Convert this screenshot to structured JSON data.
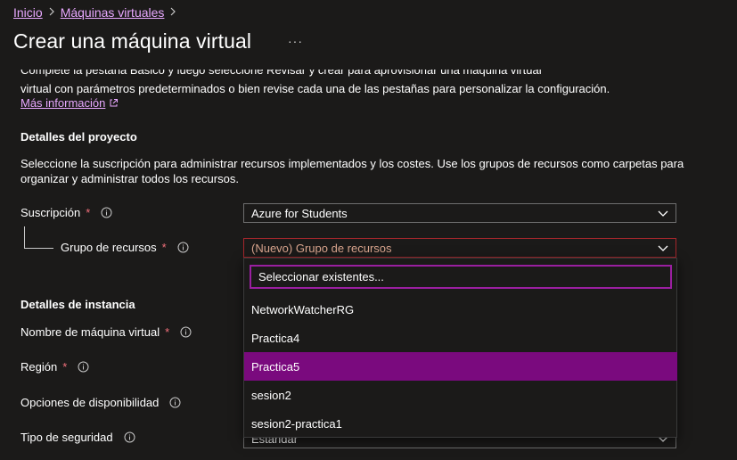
{
  "breadcrumb": {
    "home": "Inicio",
    "current": "Máquinas virtuales",
    "separator": ">"
  },
  "page": {
    "title": "Crear una máquina virtual",
    "more_label": "···"
  },
  "intro": {
    "cut_line": "Complete la pestaña Básico y luego seleccione Revisar y crear para aprovisionar una máquina virtual",
    "line2": "virtual con parámetros predeterminados o bien revise cada una de las pestañas para personalizar la configuración.",
    "more_link": "Más información"
  },
  "project": {
    "heading": "Detalles del proyecto",
    "desc1": "Seleccione la suscripción para administrar recursos implementados y los costes. Use los grupos de recursos como carpetas para",
    "desc2": "organizar y administrar todos los recursos.",
    "subscription_label": "Suscripción",
    "subscription_value": "Azure for Students",
    "resource_group_label": "Grupo de recursos",
    "resource_group_value": "(Nuevo) Grupo de recursos",
    "required_mark": "*"
  },
  "dropdown": {
    "search_placeholder": "Seleccionar existentes...",
    "options": [
      "NetworkWatcherRG",
      "Practica4",
      "Practica5",
      "sesion2",
      "sesion2-practica1"
    ],
    "selected_index": 2,
    "selected_color": "#7a0a7e"
  },
  "instance": {
    "heading": "Detalles de instancia",
    "vm_name_label": "Nombre de máquina virtual",
    "region_label": "Región",
    "availability_label": "Opciones de disponibilidad",
    "security_label": "Tipo de seguridad",
    "security_value": "Estándar"
  },
  "colors": {
    "background": "#1b1a19",
    "link": "#e8a8ff",
    "required": "#f1707b",
    "focus": "#9a1fa0",
    "error_border": "#a4262c"
  }
}
